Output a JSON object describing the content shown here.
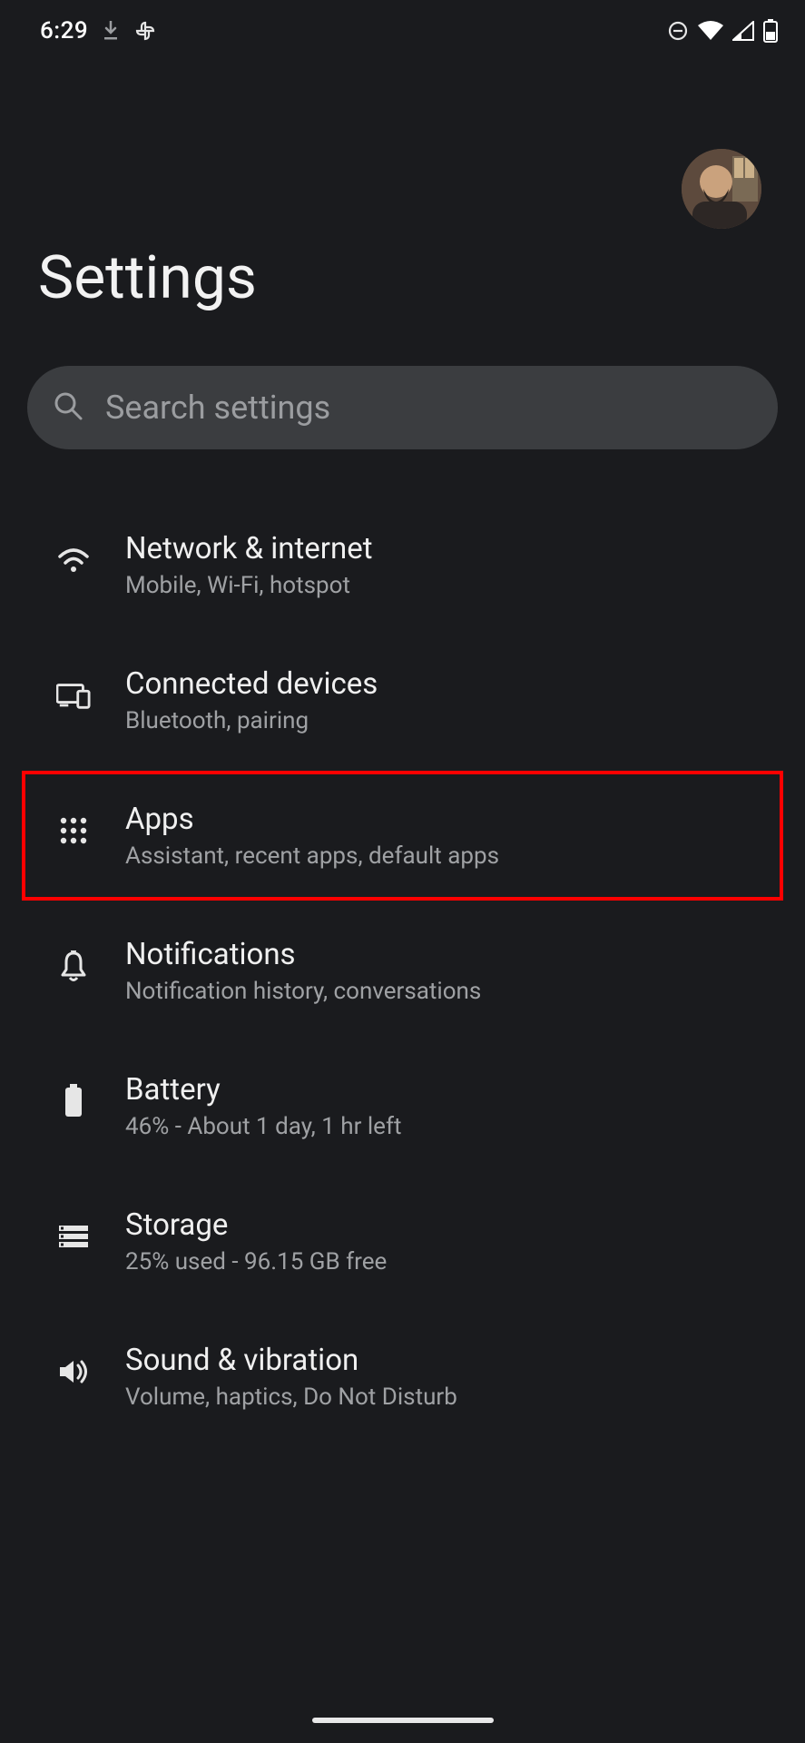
{
  "status_bar": {
    "time": "6:29"
  },
  "header": {
    "title": "Settings"
  },
  "search": {
    "placeholder": "Search settings"
  },
  "items": [
    {
      "icon": "wifi-icon",
      "title": "Network & internet",
      "subtitle": "Mobile, Wi-Fi, hotspot"
    },
    {
      "icon": "devices-icon",
      "title": "Connected devices",
      "subtitle": "Bluetooth, pairing"
    },
    {
      "icon": "apps-icon",
      "title": "Apps",
      "subtitle": "Assistant, recent apps, default apps",
      "highlighted": true
    },
    {
      "icon": "bell-icon",
      "title": "Notifications",
      "subtitle": "Notification history, conversations"
    },
    {
      "icon": "battery-icon",
      "title": "Battery",
      "subtitle": "46% - About 1 day, 1 hr left"
    },
    {
      "icon": "storage-icon",
      "title": "Storage",
      "subtitle": "25% used - 96.15 GB free"
    },
    {
      "icon": "sound-icon",
      "title": "Sound & vibration",
      "subtitle": "Volume, haptics, Do Not Disturb"
    }
  ]
}
